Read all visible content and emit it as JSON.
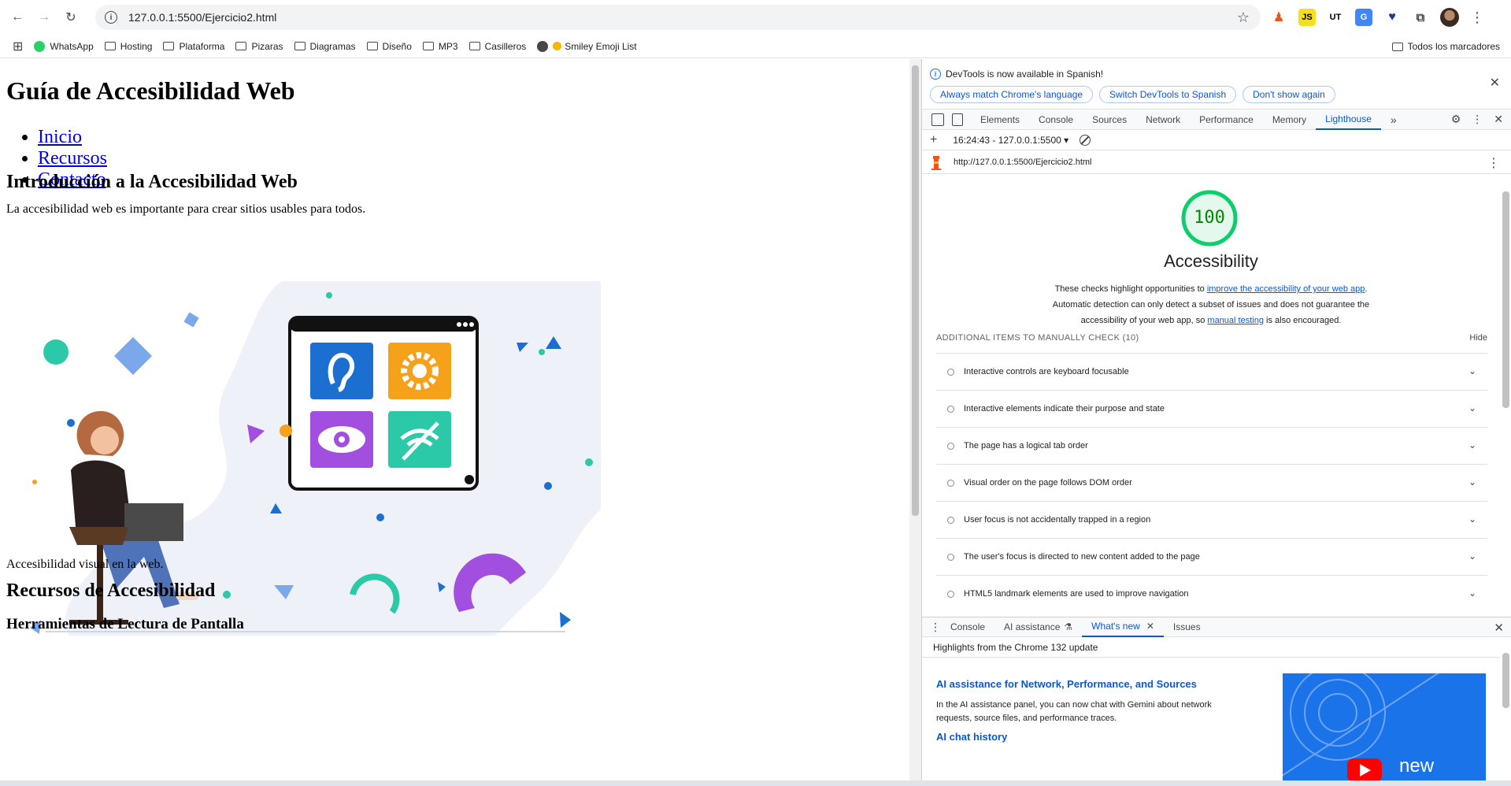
{
  "browser": {
    "url": "127.0.0.1:5500/Ejercicio2.html",
    "bookmarks": [
      "WhatsApp",
      "Hosting",
      "Plataforma",
      "Pizaras",
      "Diagramas",
      "Diseño",
      "MP3",
      "Casilleros",
      "Smiley Emoji List"
    ],
    "all_bookmarks": "Todos los marcadores"
  },
  "page": {
    "h1": "Guía de Accesibilidad Web",
    "nav": [
      "Inicio",
      "Recursos",
      "Contacto"
    ],
    "intro_heading": "Introducción a la Accesibilidad Web",
    "intro_text": "La accesibilidad web es importante para crear sitios usables para todos.",
    "caption": "Accesibilidad visual en la web.",
    "resources_heading": "Recursos de Accesibilidad",
    "tools_heading": "Herramientas de Lectura de Pantalla"
  },
  "devtools": {
    "notice": "DevTools is now available in Spanish!",
    "notice_buttons": [
      "Always match Chrome's language",
      "Switch DevTools to Spanish",
      "Don't show again"
    ],
    "tabs": [
      "Elements",
      "Console",
      "Sources",
      "Network",
      "Performance",
      "Memory",
      "Lighthouse"
    ],
    "active_tab": "Lighthouse",
    "run_label": "16:24:43 - 127.0.0.1:5500",
    "report_url": "http://127.0.0.1:5500/Ejercicio2.html",
    "score": "100",
    "category": "Accessibility",
    "desc_1": "These checks highlight opportunities to ",
    "desc_link_1": "improve the accessibility of your web app",
    "desc_2": ". Automatic detection can only detect a subset of issues and does not guarantee the accessibility of your web app, so ",
    "desc_link_2": "manual testing",
    "desc_3": " is also encouraged.",
    "manual_heading": "ADDITIONAL ITEMS TO MANUALLY CHECK (10)",
    "hide": "Hide",
    "audits": [
      "Interactive controls are keyboard focusable",
      "Interactive elements indicate their purpose and state",
      "The page has a logical tab order",
      "Visual order on the page follows DOM order",
      "User focus is not accidentally trapped in a region",
      "The user's focus is directed to new content added to the page",
      "HTML5 landmark elements are used to improve navigation"
    ],
    "drawer_tabs": [
      "Console",
      "AI assistance",
      "What's new",
      "Issues"
    ],
    "whatsnew_header": "Highlights from the Chrome 132 update",
    "whatsnew_title": "AI assistance for Network, Performance, and Sources",
    "whatsnew_text": "In the AI assistance panel, you can now chat with Gemini about network requests, source files, and performance traces.",
    "whatsnew_sub": "AI chat history",
    "video_label": "new"
  },
  "colors": {
    "accent": "#0b57d0",
    "score_green": "#0cce6b",
    "link": "#0000ee"
  }
}
